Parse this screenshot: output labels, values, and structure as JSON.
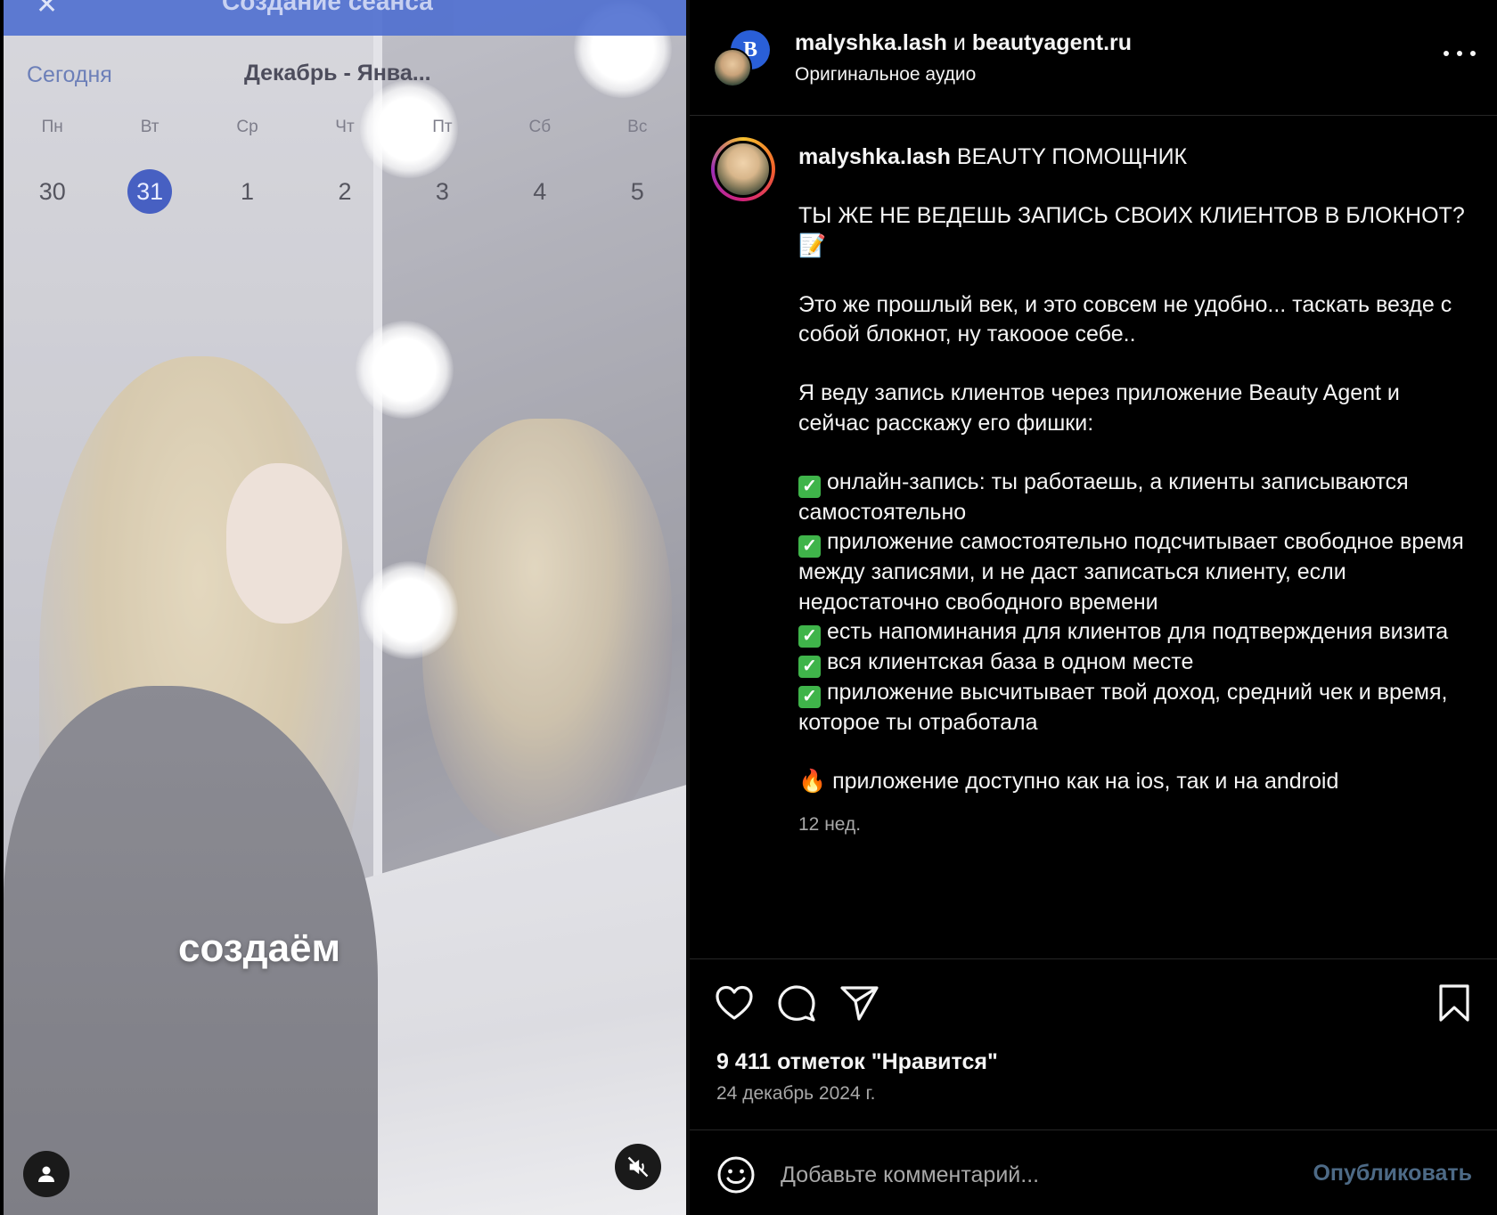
{
  "video": {
    "app_title": "Создание сеанса",
    "calendar": {
      "today_label": "Сегодня",
      "month_label": "Декабрь - Янва...",
      "weekdays": [
        "Пн",
        "Вт",
        "Ср",
        "Чт",
        "Пт",
        "Сб",
        "Вс"
      ],
      "days": [
        "30",
        "31",
        "1",
        "2",
        "3",
        "4",
        "5"
      ],
      "selected_day": "31"
    },
    "caption": "создаём",
    "accent_color": "#4760c2"
  },
  "post_header": {
    "author": "malyshka.lash",
    "conjunction": "и",
    "collaborator": "beautyagent.ru",
    "audio": "Оригинальное аудио"
  },
  "post": {
    "username": "malyshka.lash",
    "title": "BEAUTY ПОМОЩНИК",
    "headline": "ТЫ ЖЕ НЕ ВЕДЕШЬ ЗАПИСЬ СВОИХ КЛИЕНТОВ В БЛОКНОТ? 📝",
    "paragraph1": "Это же прошлый век, и это совсем не удобно... таскать везде с собой блокнот, ну такооое себе..",
    "paragraph2": "Я веду запись клиентов через приложение Beauty Agent и сейчас расскажу его фишки:",
    "features": [
      "онлайн-запись: ты работаешь, а клиенты записываются самостоятельно",
      "приложение самостоятельно подсчитывает свободное время между записями, и не даст записаться клиенту, если недостаточно свободного времени",
      "есть напоминания для клиентов для подтверждения визита",
      "вся клиентская база в одном месте",
      "приложение высчитывает твой доход, средний чек и время, которое ты отработала"
    ],
    "platforms_icon": "🔥",
    "platforms": "приложение доступно как на ios, так и на android",
    "time_ago": "12 нед."
  },
  "stats": {
    "likes": "9 411 отметок \"Нравится\"",
    "date": "24 декабрь 2024 г."
  },
  "comment": {
    "placeholder": "Добавьте комментарий...",
    "publish_label": "Опубликовать"
  },
  "icons": {
    "like": "heart-icon",
    "comment": "comment-bubble-icon",
    "share": "paper-plane-icon",
    "save": "bookmark-icon",
    "emoji": "smiley-icon",
    "more": "more-dots-icon",
    "mute": "muted-speaker-icon",
    "profile": "person-icon"
  }
}
